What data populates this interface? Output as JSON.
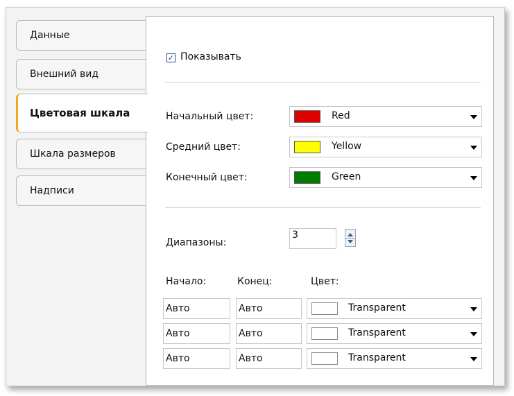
{
  "tabs": [
    {
      "label": "Данные"
    },
    {
      "label": "Внешний вид"
    },
    {
      "label": "Цветовая шкала"
    },
    {
      "label": "Шкала размеров"
    },
    {
      "label": "Надписи"
    }
  ],
  "show": {
    "label": "Показывать",
    "checked": true
  },
  "colors": {
    "start": {
      "label": "Начальный цвет:",
      "value": "Red",
      "swatch": "#e00000"
    },
    "middle": {
      "label": "Средний цвет:",
      "value": "Yellow",
      "swatch": "#ffff00"
    },
    "end": {
      "label": "Конечный цвет:",
      "value": "Green",
      "swatch": "#007c00"
    }
  },
  "ranges": {
    "label": "Диапазоны:",
    "value": "3"
  },
  "table": {
    "headers": {
      "start": "Начало:",
      "end": "Конец:",
      "color": "Цвет:"
    },
    "rows": [
      {
        "start": "Авто",
        "end": "Авто",
        "color": "Transparent"
      },
      {
        "start": "Авто",
        "end": "Авто",
        "color": "Transparent"
      },
      {
        "start": "Авто",
        "end": "Авто",
        "color": "Transparent"
      }
    ]
  }
}
